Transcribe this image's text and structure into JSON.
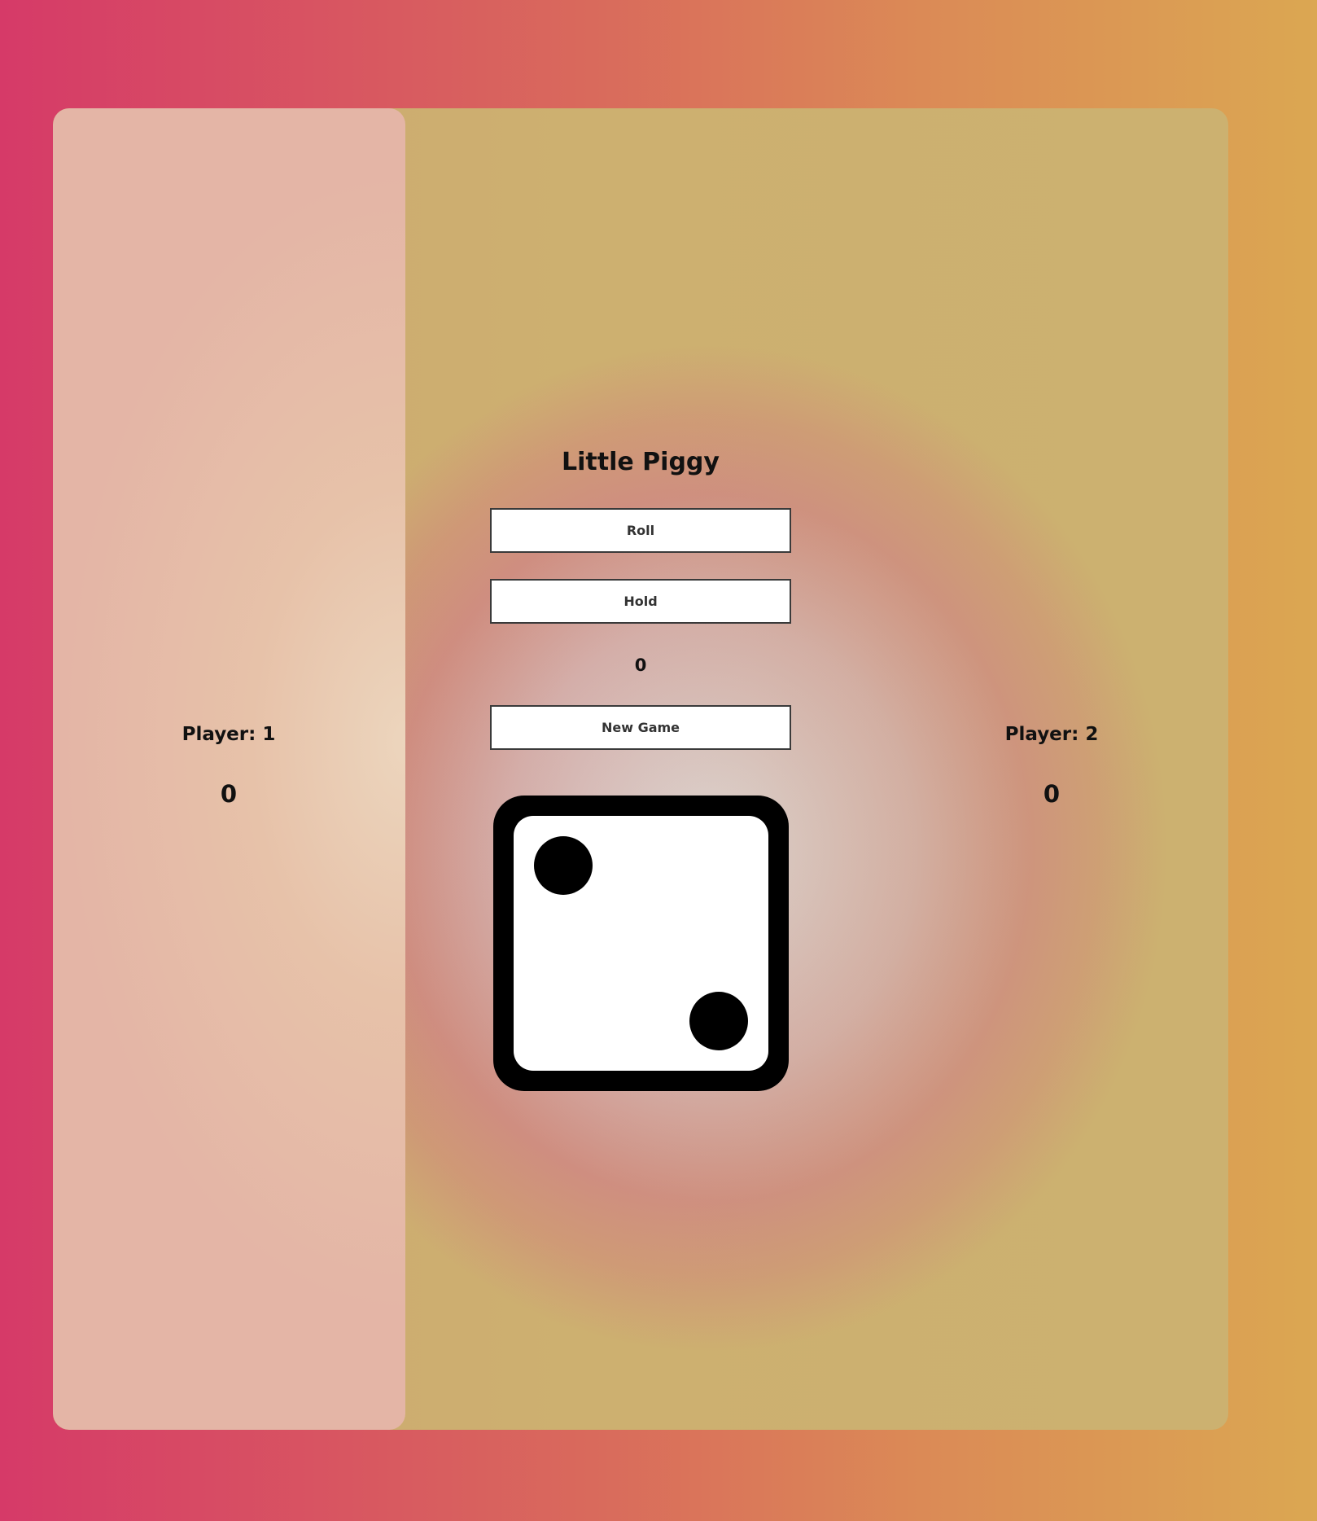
{
  "game": {
    "title": "Little Piggy",
    "turn_score": "0",
    "active_player": 1
  },
  "buttons": {
    "roll_label": "Roll",
    "hold_label": "Hold",
    "new_game_label": "New Game"
  },
  "players": [
    {
      "name": "Player: 1",
      "score": "0"
    },
    {
      "name": "Player: 2",
      "score": "0"
    }
  ],
  "die": {
    "face_value": 2
  },
  "colors": {
    "background_start": "#d63a68",
    "background_end": "#dba752",
    "die_body": "#000000",
    "die_face": "#ffffff",
    "button_border": "#3a3a3a"
  }
}
